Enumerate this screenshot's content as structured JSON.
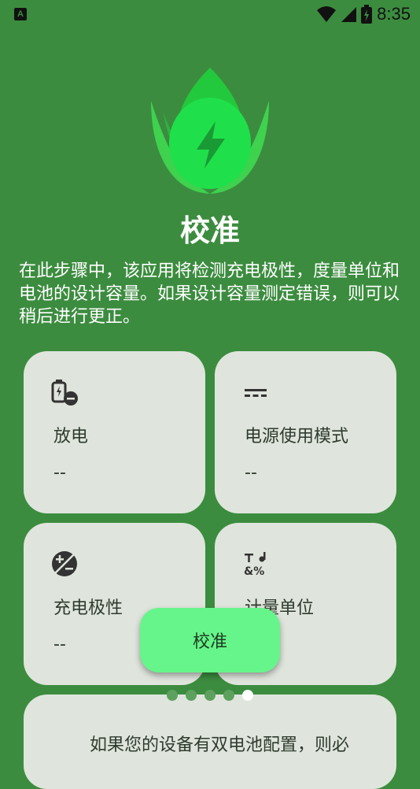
{
  "status_bar": {
    "time": "8:35",
    "app_icon_letter": "A"
  },
  "header": {
    "title": "校准",
    "description": "在此步骤中，该应用将检测充电极性，度量单位和电池的设计容量。如果设计容量测定错误，则可以稍后进行更正。"
  },
  "cards": [
    {
      "label": "放电",
      "value": "--",
      "icon": "battery-minus-icon"
    },
    {
      "label": "电源使用模式",
      "value": "--",
      "icon": "dc-power-icon"
    },
    {
      "label": "充电极性",
      "value": "--",
      "icon": "polarity-icon"
    },
    {
      "label": "计量单位",
      "value": "",
      "icon": "units-icon"
    }
  ],
  "fab": {
    "label": "校准"
  },
  "pager": {
    "total": 5,
    "active_index": 4
  },
  "note": {
    "text": "如果您的设备有双电池配置，则必"
  },
  "colors": {
    "background": "#3c8c3f",
    "card": "#dfe5dc",
    "accent": "#66f58a"
  }
}
